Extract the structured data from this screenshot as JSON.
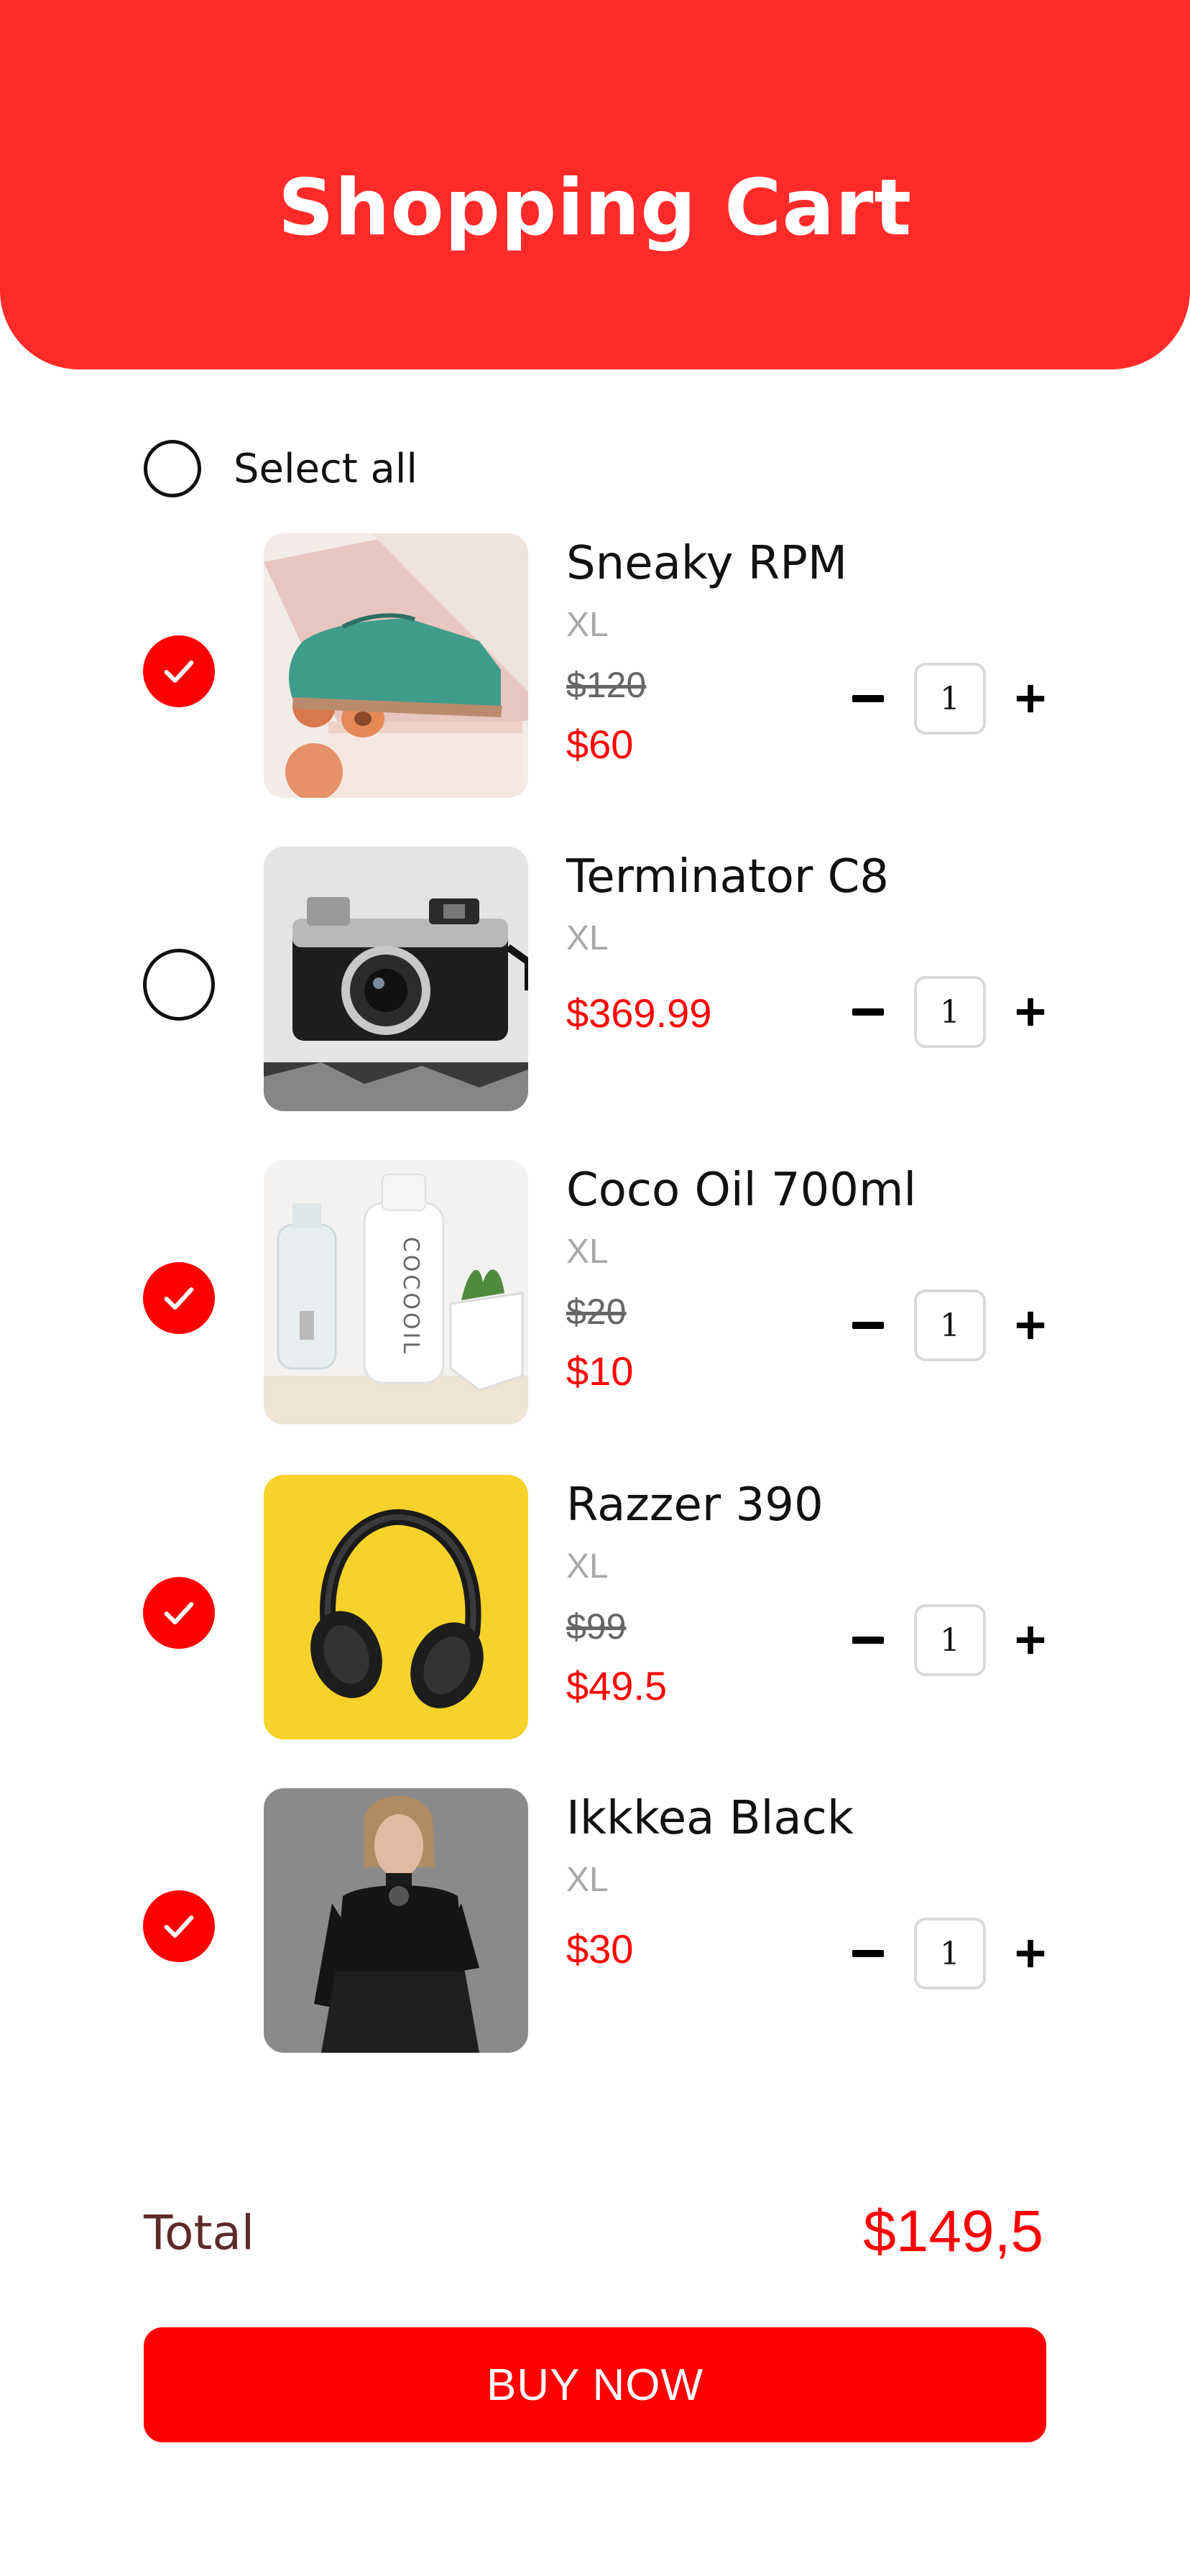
{
  "header": {
    "title": "Shopping Cart"
  },
  "select_all": {
    "label": "Select all",
    "checked": false
  },
  "items": [
    {
      "name": "Sneaky RPM",
      "size": "XL",
      "old_price": "$120",
      "price": "$60",
      "quantity": "1",
      "checked": true,
      "image": "green suede shoe"
    },
    {
      "name": "Terminator C8",
      "size": "XL",
      "old_price": "",
      "price": "$369.99",
      "quantity": "1",
      "checked": false,
      "image": "retro camera"
    },
    {
      "name": "Coco Oil 700ml",
      "size": "XL",
      "old_price": "$20",
      "price": "$10",
      "quantity": "1",
      "checked": true,
      "image": "white coco oil bottle"
    },
    {
      "name": "Razzer 390",
      "size": "XL",
      "old_price": "$99",
      "price": "$49.5",
      "quantity": "1",
      "checked": true,
      "image": "black headphones on yellow"
    },
    {
      "name": "Ikkkea Black",
      "size": "XL",
      "old_price": "",
      "price": "$30",
      "quantity": "1",
      "checked": true,
      "image": "woman in black dress"
    }
  ],
  "total": {
    "label": "Total",
    "value": "$149,5"
  },
  "buy_button": {
    "label": "BUY NOW"
  },
  "colors": {
    "accent": "#ff0000",
    "header": "#ff2b2b",
    "muted": "#a9a9a9",
    "total_label": "#5e2a2a"
  }
}
